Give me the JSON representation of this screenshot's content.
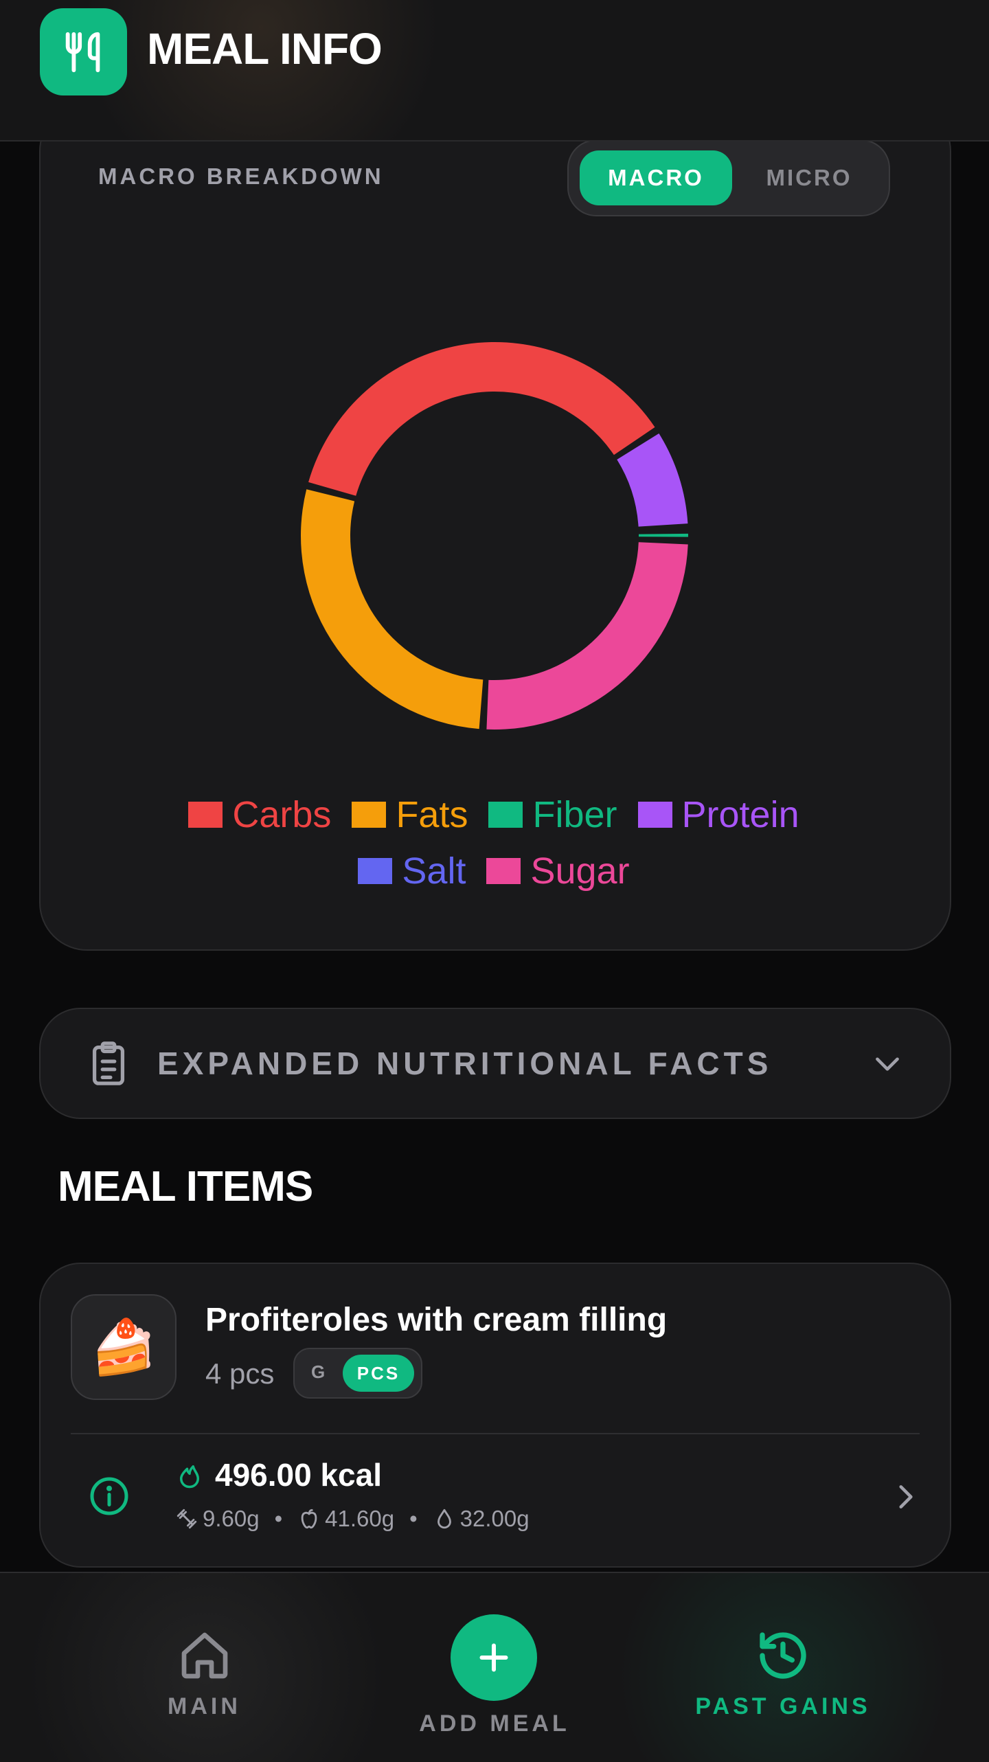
{
  "header": {
    "title": "MEAL INFO",
    "logo_icon": "fork-knife-icon"
  },
  "chart_card": {
    "label": "MACRO BREAKDOWN",
    "toggle": {
      "active": "MACRO",
      "inactive": "MICRO"
    }
  },
  "chart_data": {
    "type": "pie",
    "variant": "donut",
    "categories": [
      "Carbs",
      "Fats",
      "Fiber",
      "Protein",
      "Salt",
      "Sugar"
    ],
    "values": [
      41.6,
      32.0,
      1.0,
      9.6,
      0.25,
      29.0
    ],
    "colors": [
      "#ef4444",
      "#f59e0b",
      "#10b981",
      "#a855f7",
      "#6366f1",
      "#ec4899"
    ],
    "legend_position": "bottom"
  },
  "facts": {
    "label": "EXPANDED NUTRITIONAL FACTS",
    "icon": "clipboard-icon"
  },
  "meal_items": {
    "title": "MEAL ITEMS",
    "items": [
      {
        "name": "Profiteroles with cream filling",
        "quantity": "4 pcs",
        "unit_g": "G",
        "unit_pcs": "PCS",
        "kcal": "496.00 kcal",
        "protein": "9.60g",
        "carbs": "41.60g",
        "fat": "32.00g",
        "emoji": "🍰"
      }
    ]
  },
  "nav": {
    "main": "MAIN",
    "add": "ADD MEAL",
    "past": "PAST GAINS",
    "accent": "#10b981",
    "muted": "#8a8a90"
  }
}
